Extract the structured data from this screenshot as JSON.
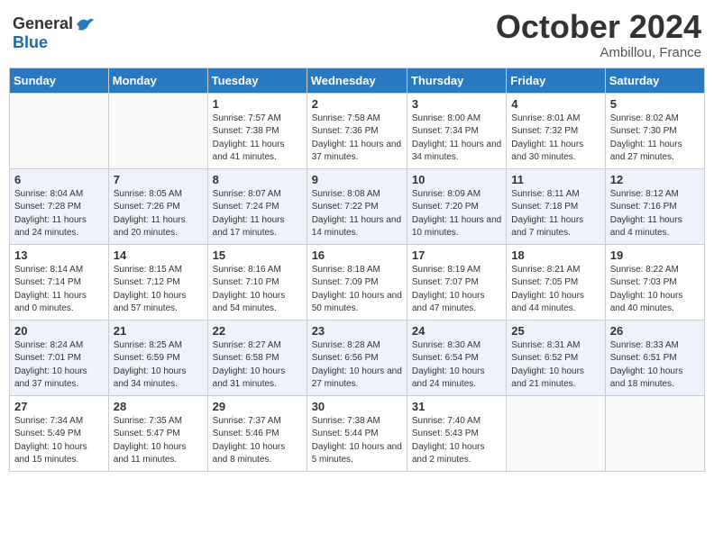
{
  "header": {
    "logo_general": "General",
    "logo_blue": "Blue",
    "month": "October 2024",
    "location": "Ambillou, France"
  },
  "weekdays": [
    "Sunday",
    "Monday",
    "Tuesday",
    "Wednesday",
    "Thursday",
    "Friday",
    "Saturday"
  ],
  "weeks": [
    [
      {
        "day": "",
        "info": ""
      },
      {
        "day": "",
        "info": ""
      },
      {
        "day": "1",
        "info": "Sunrise: 7:57 AM\nSunset: 7:38 PM\nDaylight: 11 hours and 41 minutes."
      },
      {
        "day": "2",
        "info": "Sunrise: 7:58 AM\nSunset: 7:36 PM\nDaylight: 11 hours and 37 minutes."
      },
      {
        "day": "3",
        "info": "Sunrise: 8:00 AM\nSunset: 7:34 PM\nDaylight: 11 hours and 34 minutes."
      },
      {
        "day": "4",
        "info": "Sunrise: 8:01 AM\nSunset: 7:32 PM\nDaylight: 11 hours and 30 minutes."
      },
      {
        "day": "5",
        "info": "Sunrise: 8:02 AM\nSunset: 7:30 PM\nDaylight: 11 hours and 27 minutes."
      }
    ],
    [
      {
        "day": "6",
        "info": "Sunrise: 8:04 AM\nSunset: 7:28 PM\nDaylight: 11 hours and 24 minutes."
      },
      {
        "day": "7",
        "info": "Sunrise: 8:05 AM\nSunset: 7:26 PM\nDaylight: 11 hours and 20 minutes."
      },
      {
        "day": "8",
        "info": "Sunrise: 8:07 AM\nSunset: 7:24 PM\nDaylight: 11 hours and 17 minutes."
      },
      {
        "day": "9",
        "info": "Sunrise: 8:08 AM\nSunset: 7:22 PM\nDaylight: 11 hours and 14 minutes."
      },
      {
        "day": "10",
        "info": "Sunrise: 8:09 AM\nSunset: 7:20 PM\nDaylight: 11 hours and 10 minutes."
      },
      {
        "day": "11",
        "info": "Sunrise: 8:11 AM\nSunset: 7:18 PM\nDaylight: 11 hours and 7 minutes."
      },
      {
        "day": "12",
        "info": "Sunrise: 8:12 AM\nSunset: 7:16 PM\nDaylight: 11 hours and 4 minutes."
      }
    ],
    [
      {
        "day": "13",
        "info": "Sunrise: 8:14 AM\nSunset: 7:14 PM\nDaylight: 11 hours and 0 minutes."
      },
      {
        "day": "14",
        "info": "Sunrise: 8:15 AM\nSunset: 7:12 PM\nDaylight: 10 hours and 57 minutes."
      },
      {
        "day": "15",
        "info": "Sunrise: 8:16 AM\nSunset: 7:10 PM\nDaylight: 10 hours and 54 minutes."
      },
      {
        "day": "16",
        "info": "Sunrise: 8:18 AM\nSunset: 7:09 PM\nDaylight: 10 hours and 50 minutes."
      },
      {
        "day": "17",
        "info": "Sunrise: 8:19 AM\nSunset: 7:07 PM\nDaylight: 10 hours and 47 minutes."
      },
      {
        "day": "18",
        "info": "Sunrise: 8:21 AM\nSunset: 7:05 PM\nDaylight: 10 hours and 44 minutes."
      },
      {
        "day": "19",
        "info": "Sunrise: 8:22 AM\nSunset: 7:03 PM\nDaylight: 10 hours and 40 minutes."
      }
    ],
    [
      {
        "day": "20",
        "info": "Sunrise: 8:24 AM\nSunset: 7:01 PM\nDaylight: 10 hours and 37 minutes."
      },
      {
        "day": "21",
        "info": "Sunrise: 8:25 AM\nSunset: 6:59 PM\nDaylight: 10 hours and 34 minutes."
      },
      {
        "day": "22",
        "info": "Sunrise: 8:27 AM\nSunset: 6:58 PM\nDaylight: 10 hours and 31 minutes."
      },
      {
        "day": "23",
        "info": "Sunrise: 8:28 AM\nSunset: 6:56 PM\nDaylight: 10 hours and 27 minutes."
      },
      {
        "day": "24",
        "info": "Sunrise: 8:30 AM\nSunset: 6:54 PM\nDaylight: 10 hours and 24 minutes."
      },
      {
        "day": "25",
        "info": "Sunrise: 8:31 AM\nSunset: 6:52 PM\nDaylight: 10 hours and 21 minutes."
      },
      {
        "day": "26",
        "info": "Sunrise: 8:33 AM\nSunset: 6:51 PM\nDaylight: 10 hours and 18 minutes."
      }
    ],
    [
      {
        "day": "27",
        "info": "Sunrise: 7:34 AM\nSunset: 5:49 PM\nDaylight: 10 hours and 15 minutes."
      },
      {
        "day": "28",
        "info": "Sunrise: 7:35 AM\nSunset: 5:47 PM\nDaylight: 10 hours and 11 minutes."
      },
      {
        "day": "29",
        "info": "Sunrise: 7:37 AM\nSunset: 5:46 PM\nDaylight: 10 hours and 8 minutes."
      },
      {
        "day": "30",
        "info": "Sunrise: 7:38 AM\nSunset: 5:44 PM\nDaylight: 10 hours and 5 minutes."
      },
      {
        "day": "31",
        "info": "Sunrise: 7:40 AM\nSunset: 5:43 PM\nDaylight: 10 hours and 2 minutes."
      },
      {
        "day": "",
        "info": ""
      },
      {
        "day": "",
        "info": ""
      }
    ]
  ]
}
